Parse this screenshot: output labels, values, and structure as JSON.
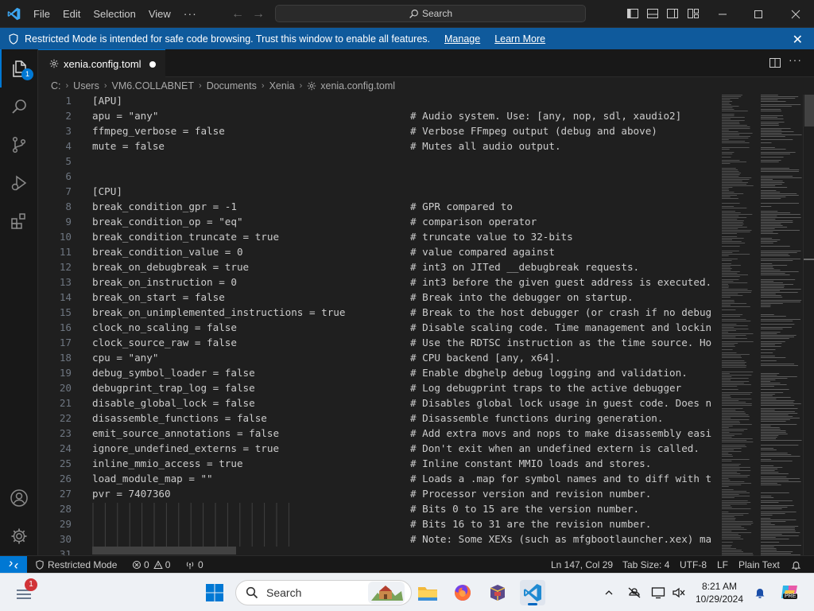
{
  "titlebar": {
    "menu": [
      "File",
      "Edit",
      "Selection",
      "View",
      "···"
    ],
    "search_label": "Search"
  },
  "banner": {
    "message": "Restricted Mode is intended for safe code browsing. Trust this window to enable all features.",
    "manage_label": "Manage",
    "learn_more_label": "Learn More"
  },
  "activitybar": {
    "explorer_badge": "1"
  },
  "tab": {
    "title": "xenia.config.toml",
    "modified": true
  },
  "breadcrumb": [
    "C:",
    "Users",
    "VM6.COLLABNET",
    "Documents",
    "Xenia",
    "xenia.config.toml"
  ],
  "editor": {
    "lines": [
      {
        "n": "1",
        "code": "[APU]",
        "comment": ""
      },
      {
        "n": "2",
        "code": "apu = \"any\"",
        "comment": "# Audio system. Use: [any, nop, sdl, xaudio2]"
      },
      {
        "n": "3",
        "code": "ffmpeg_verbose = false",
        "comment": "# Verbose FFmpeg output (debug and above)"
      },
      {
        "n": "4",
        "code": "mute = false",
        "comment": "# Mutes all audio output."
      },
      {
        "n": "5",
        "code": "",
        "comment": ""
      },
      {
        "n": "6",
        "code": "",
        "comment": ""
      },
      {
        "n": "7",
        "code": "[CPU]",
        "comment": ""
      },
      {
        "n": "8",
        "code": "break_condition_gpr = -1",
        "comment": "# GPR compared to"
      },
      {
        "n": "9",
        "code": "break_condition_op = \"eq\"",
        "comment": "# comparison operator"
      },
      {
        "n": "10",
        "code": "break_condition_truncate = true",
        "comment": "# truncate value to 32-bits"
      },
      {
        "n": "11",
        "code": "break_condition_value = 0",
        "comment": "# value compared against"
      },
      {
        "n": "12",
        "code": "break_on_debugbreak = true",
        "comment": "# int3 on JITed __debugbreak requests."
      },
      {
        "n": "13",
        "code": "break_on_instruction = 0",
        "comment": "# int3 before the given guest address is executed."
      },
      {
        "n": "14",
        "code": "break_on_start = false",
        "comment": "# Break into the debugger on startup."
      },
      {
        "n": "15",
        "code": "break_on_unimplemented_instructions = true",
        "comment": "# Break to the host debugger (or crash if no debug"
      },
      {
        "n": "16",
        "code": "clock_no_scaling = false",
        "comment": "# Disable scaling code. Time management and lockin"
      },
      {
        "n": "17",
        "code": "clock_source_raw = false",
        "comment": "# Use the RDTSC instruction as the time source. Ho"
      },
      {
        "n": "18",
        "code": "cpu = \"any\"",
        "comment": "# CPU backend [any, x64]."
      },
      {
        "n": "19",
        "code": "debug_symbol_loader = false",
        "comment": "# Enable dbghelp debug logging and validation."
      },
      {
        "n": "20",
        "code": "debugprint_trap_log = false",
        "comment": "# Log debugprint traps to the active debugger"
      },
      {
        "n": "21",
        "code": "disable_global_lock = false",
        "comment": "# Disables global lock usage in guest code. Does n"
      },
      {
        "n": "22",
        "code": "disassemble_functions = false",
        "comment": "# Disassemble functions during generation."
      },
      {
        "n": "23",
        "code": "emit_source_annotations = false",
        "comment": "# Add extra movs and nops to make disassembly easi"
      },
      {
        "n": "24",
        "code": "ignore_undefined_externs = true",
        "comment": "# Don't exit when an undefined extern is called."
      },
      {
        "n": "25",
        "code": "inline_mmio_access = true",
        "comment": "# Inline constant MMIO loads and stores."
      },
      {
        "n": "26",
        "code": "load_module_map = \"\"",
        "comment": "# Loads a .map for symbol names and to diff with t"
      },
      {
        "n": "27",
        "code": "pvr = 7407360",
        "comment": "# Processor version and revision number."
      },
      {
        "n": "28",
        "code": "",
        "comment": "# Bits 0 to 15 are the version number."
      },
      {
        "n": "29",
        "code": "",
        "comment": "# Bits 16 to 31 are the revision number."
      },
      {
        "n": "30",
        "code": "",
        "comment": "# Note: Some XEXs (such as mfgbootlauncher.xex) ma"
      },
      {
        "n": "31",
        "code": "",
        "comment": ""
      }
    ]
  },
  "statusbar": {
    "restricted_mode": "Restricted Mode",
    "errors": "0",
    "warnings": "0",
    "ports": "0",
    "cursor": "Ln 147, Col 29",
    "tab_size": "Tab Size: 4",
    "encoding": "UTF-8",
    "eol": "LF",
    "language": "Plain Text"
  },
  "taskbar": {
    "search_label": "Search",
    "notification_badge": "1",
    "time": "8:21 AM",
    "date": "10/29/2024",
    "copilot_badge": "PRE"
  },
  "colors": {
    "accent": "#0078d4",
    "banner": "#0f5a9c",
    "editor_bg": "#1f1f1f"
  }
}
